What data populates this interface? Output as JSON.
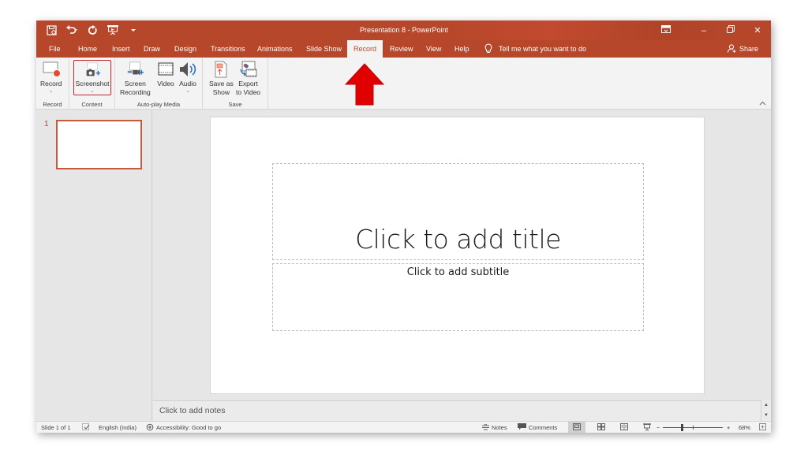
{
  "app": {
    "title": "Presentation 8  -  PowerPoint"
  },
  "quick_access": [
    {
      "name": "save-icon",
      "glyph": "save"
    },
    {
      "name": "undo-icon",
      "glyph": "undo"
    },
    {
      "name": "redo-icon",
      "glyph": "redo"
    },
    {
      "name": "present-icon",
      "glyph": "present"
    },
    {
      "name": "customize-qat-icon",
      "glyph": "caret"
    }
  ],
  "window_controls": {
    "ribbon_display": "ribbon-display-options-icon",
    "minimize": "–",
    "restore": "❐",
    "close": "✕"
  },
  "tabs": [
    {
      "label": "File"
    },
    {
      "label": "Home"
    },
    {
      "label": "Insert"
    },
    {
      "label": "Draw"
    },
    {
      "label": "Design"
    },
    {
      "label": "Transitions"
    },
    {
      "label": "Animations"
    },
    {
      "label": "Slide Show"
    },
    {
      "label": "Record",
      "active": true
    },
    {
      "label": "Review"
    },
    {
      "label": "View"
    },
    {
      "label": "Help"
    }
  ],
  "tell_me": {
    "placeholder": "Tell me what you want to do"
  },
  "share": {
    "label": "Share"
  },
  "ribbon": {
    "groups": [
      {
        "label": "Record",
        "buttons": [
          {
            "label": "Record",
            "line2": "",
            "dropdown": true
          }
        ]
      },
      {
        "label": "Content",
        "buttons": [
          {
            "label": "Screenshot",
            "line2": "",
            "dropdown": true,
            "selected": true
          }
        ]
      },
      {
        "label": "Auto-play Media",
        "buttons": [
          {
            "label": "Screen",
            "line2": "Recording"
          },
          {
            "label": "Video",
            "line2": ""
          },
          {
            "label": "Audio",
            "line2": "",
            "dropdown": true
          }
        ]
      },
      {
        "label": "Save",
        "buttons": [
          {
            "label": "Save as",
            "line2": "Show"
          },
          {
            "label": "Export",
            "line2": "to Video"
          }
        ]
      }
    ],
    "collapse_glyph": "^"
  },
  "annotation": {
    "arrow_color": "#e00000",
    "points_to": "Record"
  },
  "thumbnails": [
    {
      "number": "1"
    }
  ],
  "slide": {
    "title_placeholder": "Click to add title",
    "subtitle_placeholder": "Click to add subtitle"
  },
  "notes": {
    "placeholder": "Click to add notes"
  },
  "statusbar": {
    "slide_counter": "Slide 1 of 1",
    "language": "English (India)",
    "accessibility": "Accessibility: Good to go",
    "notes_label": "Notes",
    "comments_label": "Comments",
    "zoom_minus": "−",
    "zoom_plus": "+",
    "zoom_level": "68%",
    "zoom_fraction": 0.68
  },
  "colors": {
    "accent": "#b7472a",
    "ribbon_bg": "#f3f3f3",
    "workspace_bg": "#e6e6e6"
  }
}
